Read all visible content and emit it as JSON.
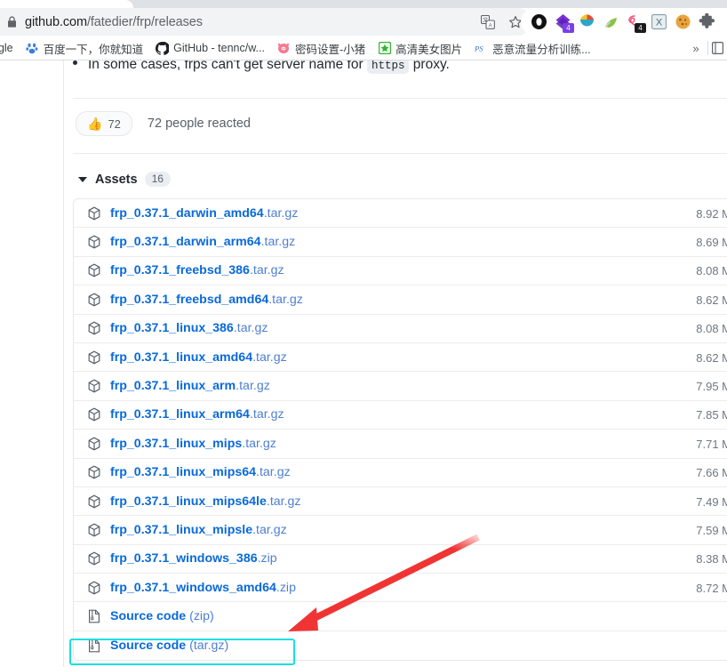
{
  "browser": {
    "url_secure_prefix": "github.com",
    "url_path": "/fatedier/frp/releases",
    "url_full": "github.com/fatedier/frp/releases",
    "lock_icon": "lock-icon",
    "omnibox_icons": [
      {
        "name": "translate-icon",
        "glyph": "translate"
      },
      {
        "name": "bookmark-star-icon",
        "glyph": "star"
      }
    ],
    "extensions": [
      {
        "name": "extension-black-ring",
        "color": "#111111",
        "badge": "",
        "badge_color": ""
      },
      {
        "name": "extension-purple-diamond",
        "color": "#7b2fd6",
        "badge": "4",
        "badge_color": "#7b3fe4"
      },
      {
        "name": "extension-colorful-drop",
        "color": "#f0b429",
        "badge": "",
        "badge_color": ""
      },
      {
        "name": "extension-green-leaf",
        "color": "#7cb342",
        "badge": "",
        "badge_color": ""
      },
      {
        "name": "extension-red-loop",
        "color": "#f4547a",
        "badge": "4",
        "badge_color": "#1b1b1b"
      },
      {
        "name": "extension-x-square",
        "color": "#4a6f7c",
        "badge": "",
        "badge_color": ""
      },
      {
        "name": "extension-cookie",
        "color": "#e59b3c",
        "badge": "",
        "badge_color": ""
      },
      {
        "name": "extension-puzzle-piece",
        "color": "#5f6368",
        "badge": "",
        "badge_color": ""
      }
    ],
    "bookmarks": [
      {
        "name": "bookmark-google",
        "label": "ogle",
        "icon": "",
        "icon_color": ""
      },
      {
        "name": "bookmark-baidu",
        "label": "百度一下，你就知道",
        "icon": "paw",
        "icon_color": "#3a7fe0"
      },
      {
        "name": "bookmark-github-tennc",
        "label": "GitHub - tennc/w...",
        "icon": "github",
        "icon_color": "#1b1f23"
      },
      {
        "name": "bookmark-password-settings",
        "label": "密码设置-小猪",
        "icon": "pig",
        "icon_color": "#f06292"
      },
      {
        "name": "bookmark-hd-images",
        "label": "高清美女图片",
        "icon": "star-green",
        "icon_color": "#2eb82e"
      },
      {
        "name": "bookmark-traffic-analysis",
        "label": "恶意流量分析训练...",
        "icon": "ps",
        "icon_color": "#2f6fd0"
      }
    ],
    "bookmark_overflow_label": "»"
  },
  "content": {
    "note_bullet": "In some cases, frps can't get server name for",
    "note_code": "https",
    "note_tail": "proxy.",
    "reaction": {
      "emoji": "👍",
      "count": "72",
      "summary": "72 people reacted"
    },
    "assets": {
      "title": "Assets",
      "count": "16",
      "caret_icon": "caret-down-icon",
      "rows": [
        {
          "name": "frp_0.37.1_darwin_amd64",
          "suffix": ".tar.gz",
          "size": "8.92 M",
          "icon": "package-icon",
          "highlighted": false
        },
        {
          "name": "frp_0.37.1_darwin_arm64",
          "suffix": ".tar.gz",
          "size": "8.69 M",
          "icon": "package-icon",
          "highlighted": false
        },
        {
          "name": "frp_0.37.1_freebsd_386",
          "suffix": ".tar.gz",
          "size": "8.08 M",
          "icon": "package-icon",
          "highlighted": false
        },
        {
          "name": "frp_0.37.1_freebsd_amd64",
          "suffix": ".tar.gz",
          "size": "8.62 M",
          "icon": "package-icon",
          "highlighted": false
        },
        {
          "name": "frp_0.37.1_linux_386",
          "suffix": ".tar.gz",
          "size": "8.08 M",
          "icon": "package-icon",
          "highlighted": false
        },
        {
          "name": "frp_0.37.1_linux_amd64",
          "suffix": ".tar.gz",
          "size": "8.62 M",
          "icon": "package-icon",
          "highlighted": false
        },
        {
          "name": "frp_0.37.1_linux_arm",
          "suffix": ".tar.gz",
          "size": "7.95 M",
          "icon": "package-icon",
          "highlighted": false
        },
        {
          "name": "frp_0.37.1_linux_arm64",
          "suffix": ".tar.gz",
          "size": "7.85 M",
          "icon": "package-icon",
          "highlighted": false
        },
        {
          "name": "frp_0.37.1_linux_mips",
          "suffix": ".tar.gz",
          "size": "7.71 M",
          "icon": "package-icon",
          "highlighted": false
        },
        {
          "name": "frp_0.37.1_linux_mips64",
          "suffix": ".tar.gz",
          "size": "7.66 M",
          "icon": "package-icon",
          "highlighted": false
        },
        {
          "name": "frp_0.37.1_linux_mips64le",
          "suffix": ".tar.gz",
          "size": "7.49 M",
          "icon": "package-icon",
          "highlighted": false
        },
        {
          "name": "frp_0.37.1_linux_mipsle",
          "suffix": ".tar.gz",
          "size": "7.59 M",
          "icon": "package-icon",
          "highlighted": false
        },
        {
          "name": "frp_0.37.1_windows_386",
          "suffix": ".zip",
          "size": "8.38 M",
          "icon": "package-icon",
          "highlighted": false
        },
        {
          "name": "frp_0.37.1_windows_amd64",
          "suffix": ".zip",
          "size": "8.72 M",
          "icon": "package-icon",
          "highlighted": true
        },
        {
          "name": "Source code",
          "suffix": " (zip)",
          "size": "",
          "icon": "file-zip-icon",
          "highlighted": false
        },
        {
          "name": "Source code",
          "suffix": " (tar.gz)",
          "size": "",
          "icon": "file-zip-icon",
          "highlighted": false
        }
      ]
    }
  },
  "annotations": {
    "highlight_color": "#18e0e0",
    "arrow_color": "#f03434",
    "highlight_target": "frp_0.37.1_windows_amd64.zip"
  }
}
